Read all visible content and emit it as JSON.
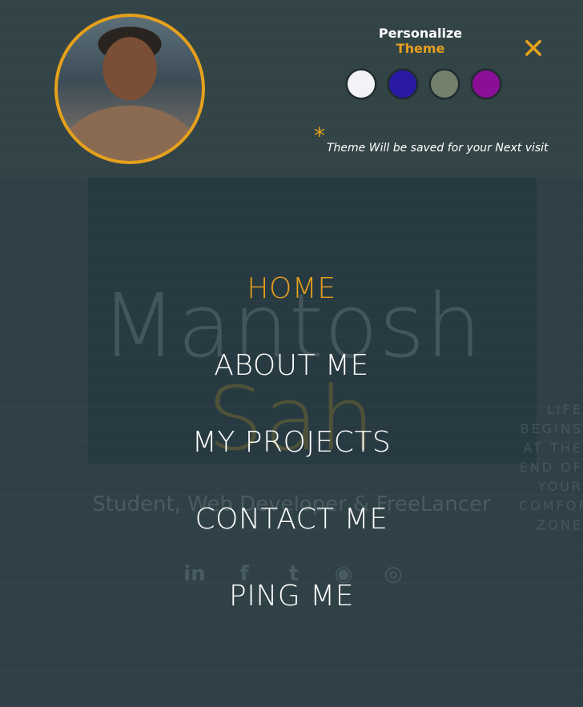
{
  "hero": {
    "first_name": "Mantosh",
    "last_name": "Sah",
    "subtitle": "Student, Web Developer & FreeLancer",
    "side_quote": "LIFE BEGINS AT THE END OF YOUR COMFORT ZONE",
    "social": [
      {
        "icon": "linkedin-icon",
        "glyph": "in"
      },
      {
        "icon": "facebook-icon",
        "glyph": "f"
      },
      {
        "icon": "twitter-icon",
        "glyph": "t"
      },
      {
        "icon": "github-icon",
        "glyph": "◉"
      },
      {
        "icon": "instagram-icon",
        "glyph": "◎"
      }
    ]
  },
  "theme": {
    "title_main": "Personalize ",
    "title_accent": "Theme",
    "swatches": [
      {
        "name": "swatch-white",
        "color": "#f3f3f7"
      },
      {
        "name": "swatch-blue",
        "color": "#2a1aa3"
      },
      {
        "name": "swatch-green",
        "color": "#73806c"
      },
      {
        "name": "swatch-purple",
        "color": "#8a0f96"
      }
    ],
    "asterisk": "*",
    "note": "Theme Will be saved for your Next visit",
    "close_glyph": "✕"
  },
  "menu": {
    "items": [
      "HOME",
      "ABOUT ME",
      "MY PROJECTS",
      "CONTACT ME",
      "PING ME"
    ],
    "active_index": 0
  },
  "colors": {
    "accent": "#e5a01c",
    "overlay": "#344448",
    "text": "#ffffff"
  }
}
